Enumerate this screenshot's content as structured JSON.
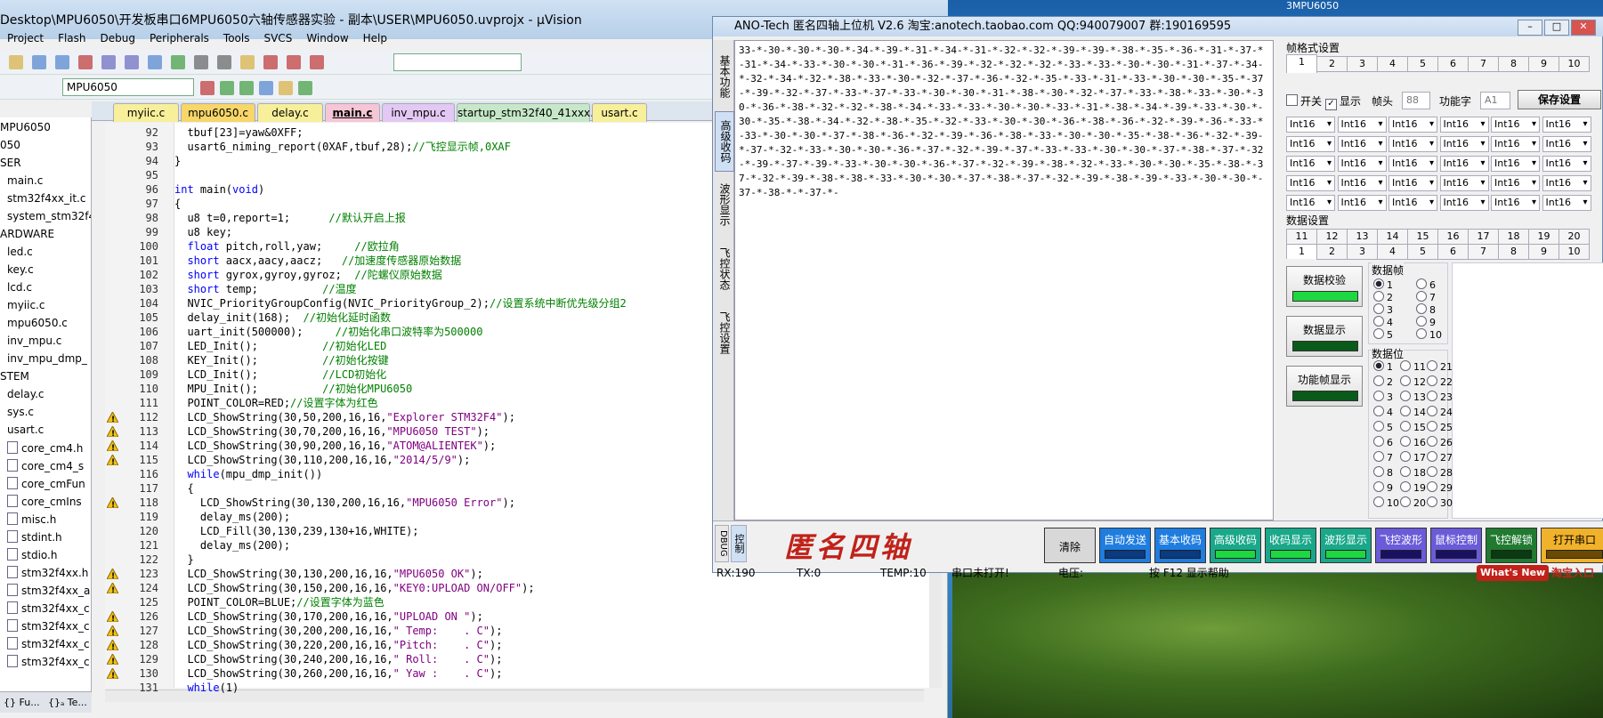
{
  "desktop": {
    "label": "3MPU6050"
  },
  "keil": {
    "title": "Desktop\\MPU6050\\开发板串口6MPU6050六轴传感器实验 - 副本\\USER\\MPU6050.uvprojx - µVision",
    "menu": [
      "Project",
      "Flash",
      "Debug",
      "Peripherals",
      "Tools",
      "SVCS",
      "Window",
      "Help"
    ],
    "target": "MPU6050",
    "tree": [
      {
        "label": "MPU6050",
        "indent": 0,
        "file": false
      },
      {
        "label": "050",
        "indent": 0,
        "file": false
      },
      {
        "label": "SER",
        "indent": 0,
        "file": false
      },
      {
        "label": "main.c",
        "indent": 8,
        "file": false
      },
      {
        "label": "stm32f4xx_it.c",
        "indent": 8,
        "file": false
      },
      {
        "label": "system_stm32f4",
        "indent": 8,
        "file": false
      },
      {
        "label": "ARDWARE",
        "indent": 0,
        "file": false
      },
      {
        "label": "led.c",
        "indent": 8,
        "file": false
      },
      {
        "label": "key.c",
        "indent": 8,
        "file": false
      },
      {
        "label": "lcd.c",
        "indent": 8,
        "file": false
      },
      {
        "label": "myiic.c",
        "indent": 8,
        "file": false
      },
      {
        "label": "mpu6050.c",
        "indent": 8,
        "file": false
      },
      {
        "label": "inv_mpu.c",
        "indent": 8,
        "file": false
      },
      {
        "label": "inv_mpu_dmp_",
        "indent": 8,
        "file": false
      },
      {
        "label": "STEM",
        "indent": 0,
        "file": false
      },
      {
        "label": "delay.c",
        "indent": 8,
        "file": false
      },
      {
        "label": "sys.c",
        "indent": 8,
        "file": false
      },
      {
        "label": "usart.c",
        "indent": 8,
        "file": false
      },
      {
        "label": "core_cm4.h",
        "indent": 8,
        "file": true
      },
      {
        "label": "core_cm4_s",
        "indent": 8,
        "file": true
      },
      {
        "label": "core_cmFun",
        "indent": 8,
        "file": true
      },
      {
        "label": "core_cmIns",
        "indent": 8,
        "file": true
      },
      {
        "label": "misc.h",
        "indent": 8,
        "file": true
      },
      {
        "label": "stdint.h",
        "indent": 8,
        "file": true
      },
      {
        "label": "stdio.h",
        "indent": 8,
        "file": true
      },
      {
        "label": "stm32f4xx.h",
        "indent": 8,
        "file": true
      },
      {
        "label": "stm32f4xx_a",
        "indent": 8,
        "file": true
      },
      {
        "label": "stm32f4xx_c",
        "indent": 8,
        "file": true
      },
      {
        "label": "stm32f4xx_c",
        "indent": 8,
        "file": true
      },
      {
        "label": "stm32f4xx_c",
        "indent": 8,
        "file": true
      },
      {
        "label": "stm32f4xx_c",
        "indent": 8,
        "file": true
      }
    ],
    "tree_tabs": [
      "{} Fu...",
      "{}ₐ Te..."
    ],
    "file_tabs": [
      {
        "label": "myiic.c",
        "color": "#f7ef9a"
      },
      {
        "label": "mpu6050.c",
        "color": "#f7d66a"
      },
      {
        "label": "delay.c",
        "color": "#f7ef9a"
      },
      {
        "label": "main.c",
        "color": "#f6c6d6"
      },
      {
        "label": "inv_mpu.c",
        "color": "#e2c8f2"
      },
      {
        "label": "startup_stm32f40_41xxx.s",
        "color": "#c6e8c8"
      },
      {
        "label": "usart.c",
        "color": "#f7ef9a"
      }
    ],
    "code": [
      {
        "n": "92",
        "w": false,
        "parts": [
          [
            "",
            "  tbuf[23]=yaw&0XFF;"
          ]
        ]
      },
      {
        "n": "93",
        "w": false,
        "parts": [
          [
            "",
            "  usart6_niming_report(0XAF,tbuf,28);"
          ],
          [
            "cm",
            "//飞控显示帧,0XAF"
          ]
        ]
      },
      {
        "n": "94",
        "w": false,
        "parts": [
          [
            "",
            "}"
          ]
        ]
      },
      {
        "n": "95",
        "w": false,
        "parts": [
          [
            "",
            ""
          ]
        ]
      },
      {
        "n": "96",
        "w": false,
        "parts": [
          [
            "kw",
            "int"
          ],
          [
            "",
            " main("
          ],
          [
            "kw",
            "void"
          ],
          [
            "",
            ")"
          ]
        ]
      },
      {
        "n": "97",
        "w": false,
        "parts": [
          [
            "",
            "{"
          ]
        ]
      },
      {
        "n": "98",
        "w": false,
        "parts": [
          [
            "",
            "  u8 t=0,report=1;      "
          ],
          [
            "cm",
            "//默认开启上报"
          ]
        ]
      },
      {
        "n": "99",
        "w": false,
        "parts": [
          [
            "",
            "  u8 key;"
          ]
        ]
      },
      {
        "n": "100",
        "w": false,
        "parts": [
          [
            "kw",
            "  float"
          ],
          [
            "",
            " pitch,roll,yaw;     "
          ],
          [
            "cm",
            "//欧拉角"
          ]
        ]
      },
      {
        "n": "101",
        "w": false,
        "parts": [
          [
            "kw",
            "  short"
          ],
          [
            "",
            " aacx,aacy,aacz;   "
          ],
          [
            "cm",
            "//加速度传感器原始数据"
          ]
        ]
      },
      {
        "n": "102",
        "w": false,
        "parts": [
          [
            "kw",
            "  short"
          ],
          [
            "",
            " gyrox,gyroy,gyroz;  "
          ],
          [
            "cm",
            "//陀螺仪原始数据"
          ]
        ]
      },
      {
        "n": "103",
        "w": false,
        "parts": [
          [
            "kw",
            "  short"
          ],
          [
            "",
            " temp;          "
          ],
          [
            "cm",
            "//温度"
          ]
        ]
      },
      {
        "n": "104",
        "w": false,
        "parts": [
          [
            "",
            "  NVIC_PriorityGroupConfig(NVIC_PriorityGroup_2);"
          ],
          [
            "cm",
            "//设置系统中断优先级分组2"
          ]
        ]
      },
      {
        "n": "105",
        "w": false,
        "parts": [
          [
            "",
            "  delay_init(168);  "
          ],
          [
            "cm",
            "//初始化延时函数"
          ]
        ]
      },
      {
        "n": "106",
        "w": false,
        "parts": [
          [
            "",
            "  uart_init(500000);     "
          ],
          [
            "cm",
            "//初始化串口波特率为500000"
          ]
        ]
      },
      {
        "n": "107",
        "w": false,
        "parts": [
          [
            "",
            "  LED_Init();          "
          ],
          [
            "cm",
            "//初始化LED"
          ]
        ]
      },
      {
        "n": "108",
        "w": false,
        "parts": [
          [
            "",
            "  KEY_Init();          "
          ],
          [
            "cm",
            "//初始化按键"
          ]
        ]
      },
      {
        "n": "109",
        "w": false,
        "parts": [
          [
            "",
            "  LCD_Init();          "
          ],
          [
            "cm",
            "//LCD初始化"
          ]
        ]
      },
      {
        "n": "110",
        "w": false,
        "parts": [
          [
            "",
            "  MPU_Init();          "
          ],
          [
            "cm",
            "//初始化MPU6050"
          ]
        ]
      },
      {
        "n": "111",
        "w": false,
        "parts": [
          [
            "",
            "  POINT_COLOR=RED;"
          ],
          [
            "cm",
            "//设置字体为红色"
          ]
        ]
      },
      {
        "n": "112",
        "w": true,
        "parts": [
          [
            "",
            "  LCD_ShowString(30,50,200,16,16,"
          ],
          [
            "st",
            "\"Explorer STM32F4\""
          ],
          [
            "",
            ");"
          ]
        ]
      },
      {
        "n": "113",
        "w": true,
        "parts": [
          [
            "",
            "  LCD_ShowString(30,70,200,16,16,"
          ],
          [
            "st",
            "\"MPU6050 TEST\""
          ],
          [
            "",
            ");"
          ]
        ]
      },
      {
        "n": "114",
        "w": true,
        "parts": [
          [
            "",
            "  LCD_ShowString(30,90,200,16,16,"
          ],
          [
            "st",
            "\"ATOM@ALIENTEK\""
          ],
          [
            "",
            ");"
          ]
        ]
      },
      {
        "n": "115",
        "w": true,
        "parts": [
          [
            "",
            "  LCD_ShowString(30,110,200,16,16,"
          ],
          [
            "st",
            "\"2014/5/9\""
          ],
          [
            "",
            ");"
          ]
        ]
      },
      {
        "n": "116",
        "w": false,
        "parts": [
          [
            "kw",
            "  while"
          ],
          [
            "",
            "(mpu_dmp_init())"
          ]
        ]
      },
      {
        "n": "117",
        "w": false,
        "parts": [
          [
            "",
            "  {"
          ]
        ]
      },
      {
        "n": "118",
        "w": true,
        "parts": [
          [
            "",
            "    LCD_ShowString(30,130,200,16,16,"
          ],
          [
            "st",
            "\"MPU6050 Error\""
          ],
          [
            "",
            ");"
          ]
        ]
      },
      {
        "n": "119",
        "w": false,
        "parts": [
          [
            "",
            "    delay_ms(200);"
          ]
        ]
      },
      {
        "n": "120",
        "w": false,
        "parts": [
          [
            "",
            "    LCD_Fill(30,130,239,130+16,WHITE);"
          ]
        ]
      },
      {
        "n": "121",
        "w": false,
        "parts": [
          [
            "",
            "    delay_ms(200);"
          ]
        ]
      },
      {
        "n": "122",
        "w": false,
        "parts": [
          [
            "",
            "  }"
          ]
        ]
      },
      {
        "n": "123",
        "w": true,
        "parts": [
          [
            "",
            "  LCD_ShowString(30,130,200,16,16,"
          ],
          [
            "st",
            "\"MPU6050 OK\""
          ],
          [
            "",
            ");"
          ]
        ]
      },
      {
        "n": "124",
        "w": true,
        "parts": [
          [
            "",
            "  LCD_ShowString(30,150,200,16,16,"
          ],
          [
            "st",
            "\"KEY0:UPLOAD ON/OFF\""
          ],
          [
            "",
            ");"
          ]
        ]
      },
      {
        "n": "125",
        "w": false,
        "parts": [
          [
            "",
            "  POINT_COLOR=BLUE;"
          ],
          [
            "cm",
            "//设置字体为蓝色"
          ]
        ]
      },
      {
        "n": "126",
        "w": true,
        "parts": [
          [
            "",
            "  LCD_ShowString(30,170,200,16,16,"
          ],
          [
            "st",
            "\"UPLOAD ON \""
          ],
          [
            "",
            ");"
          ]
        ]
      },
      {
        "n": "127",
        "w": true,
        "parts": [
          [
            "",
            "  LCD_ShowString(30,200,200,16,16,"
          ],
          [
            "st",
            "\" Temp:    . C\""
          ],
          [
            "",
            ");"
          ]
        ]
      },
      {
        "n": "128",
        "w": true,
        "parts": [
          [
            "",
            "  LCD_ShowString(30,220,200,16,16,"
          ],
          [
            "st",
            "\"Pitch:    . C\""
          ],
          [
            "",
            ");"
          ]
        ]
      },
      {
        "n": "129",
        "w": true,
        "parts": [
          [
            "",
            "  LCD_ShowString(30,240,200,16,16,"
          ],
          [
            "st",
            "\" Roll:    . C\""
          ],
          [
            "",
            ");"
          ]
        ]
      },
      {
        "n": "130",
        "w": true,
        "parts": [
          [
            "",
            "  LCD_ShowString(30,260,200,16,16,"
          ],
          [
            "st",
            "\" Yaw :    . C\""
          ],
          [
            "",
            ");"
          ]
        ]
      },
      {
        "n": "131",
        "w": false,
        "parts": [
          [
            "kw",
            "  while"
          ],
          [
            "",
            "(1)"
          ]
        ]
      }
    ]
  },
  "ano": {
    "title": "ANO-Tech   匿名四轴上位机   V2.6   淘宝:anotech.taobao.com   QQ:940079007   群:190169595",
    "side_tabs": [
      "基本功能",
      "高级收码",
      "波形显示",
      "飞控状态",
      "飞控设置"
    ],
    "rx_text": "33-*-30-*-30-*-30-*-34-*-39-*-31-*-34-*-31-*-32-*-32-*-39-*-39-*-38-*-35-*-36-*-31-*-37-*-31-*-34-*-33-*-30-*-30-*-31-*-36-*-39-*-32-*-32-*-32-*-33-*-33-*-30-*-30-*-31-*-37-*-34-*-32-*-34-*-32-*-38-*-33-*-30-*-32-*-37-*-36-*-32-*-35-*-33-*-31-*-33-*-30-*-30-*-35-*-37-*-39-*-32-*-37-*-33-*-37-*-33-*-30-*-30-*-31-*-38-*-30-*-32-*-37-*-33-*-38-*-33-*-30-*-30-*-36-*-38-*-32-*-32-*-38-*-34-*-33-*-33-*-30-*-30-*-33-*-31-*-38-*-34-*-39-*-33-*-30-*-30-*-35-*-38-*-34-*-32-*-38-*-35-*-32-*-33-*-30-*-30-*-36-*-38-*-36-*-32-*-39-*-36-*-33-*-33-*-30-*-30-*-37-*-38-*-36-*-32-*-39-*-36-*-38-*-33-*-30-*-30-*-35-*-38-*-36-*-32-*-39-*-37-*-32-*-33-*-30-*-30-*-36-*-37-*-32-*-39-*-37-*-33-*-33-*-30-*-30-*-37-*-38-*-37-*-32-*-39-*-37-*-39-*-33-*-30-*-30-*-36-*-37-*-32-*-39-*-38-*-32-*-33-*-30-*-30-*-35-*-38-*-37-*-32-*-39-*-38-*-38-*-33-*-30-*-30-*-37-*-38-*-37-*-32-*-39-*-38-*-39-*-33-*-30-*-30-*-37-*-38-*-*-37-*-",
    "frame_fmt_title": "帧格式设置",
    "frame_tabs": [
      "1",
      "2",
      "3",
      "4",
      "5",
      "6",
      "7",
      "8",
      "9",
      "10"
    ],
    "chk_open": "开关",
    "chk_show": "显示",
    "head_label": "帧头",
    "head_value": "88",
    "func_label": "功能字",
    "func_value": "A1",
    "save_btn": "保存设置",
    "type_label": "Int16",
    "data_set_title": "数据设置",
    "data_tabs_top": [
      "11",
      "12",
      "13",
      "14",
      "15",
      "16",
      "17",
      "18",
      "19",
      "20"
    ],
    "data_tabs_bot": [
      "1",
      "2",
      "3",
      "4",
      "5",
      "6",
      "7",
      "8",
      "9",
      "10"
    ],
    "btn_verify": "数据校验",
    "btn_display": "数据显示",
    "btn_func_frame": "功能帧显示",
    "frame_title": "数据帧",
    "frame_radios": [
      "1",
      "2",
      "3",
      "4",
      "5",
      "6",
      "7",
      "8",
      "9",
      "10"
    ],
    "bit_title": "数据位",
    "bit_radios": [
      "1",
      "2",
      "3",
      "4",
      "5",
      "6",
      "7",
      "8",
      "9",
      "10",
      "11",
      "12",
      "13",
      "14",
      "15",
      "16",
      "17",
      "18",
      "19",
      "20",
      "21",
      "22",
      "23",
      "24",
      "25",
      "26",
      "27",
      "28",
      "29",
      "30"
    ],
    "dbug_tabs": [
      "DBUG",
      "控制"
    ],
    "logo": "匿名四轴",
    "func_buttons": [
      {
        "label": "清除",
        "bg": "#d8d8d8",
        "fg": "#000",
        "bar": ""
      },
      {
        "label": "自动发送",
        "bg": "#1f7de0",
        "fg": "#fff",
        "bar": "#0a3a80"
      },
      {
        "label": "基本收码",
        "bg": "#1f7de0",
        "fg": "#fff",
        "bar": "#0a3a80"
      },
      {
        "label": "高级收码",
        "bg": "#1aa88a",
        "fg": "#fff",
        "bar": "#1dd840"
      },
      {
        "label": "收码显示",
        "bg": "#1aa88a",
        "fg": "#fff",
        "bar": "#1dd840"
      },
      {
        "label": "波形显示",
        "bg": "#1aa88a",
        "fg": "#fff",
        "bar": "#1dd840"
      },
      {
        "label": "飞控波形",
        "bg": "#6a5bd8",
        "fg": "#fff",
        "bar": "#1a1060"
      },
      {
        "label": "鼠标控制",
        "bg": "#6a5bd8",
        "fg": "#fff",
        "bar": "#1a1060"
      },
      {
        "label": "飞控解锁",
        "bg": "#207a30",
        "fg": "#fff",
        "bar": "#0a3a10"
      },
      {
        "label": "打开串口",
        "bg": "#f0b22a",
        "fg": "#000",
        "bar": "#6a4a00"
      }
    ],
    "status": {
      "rx": "RX:190",
      "tx": "TX:0",
      "temp": "TEMP:10",
      "port": "串口未打开!",
      "volt": "电压:",
      "help": "按 F12 显示帮助",
      "whats_new": "What's New",
      "taobao": "淘宝入口"
    }
  }
}
